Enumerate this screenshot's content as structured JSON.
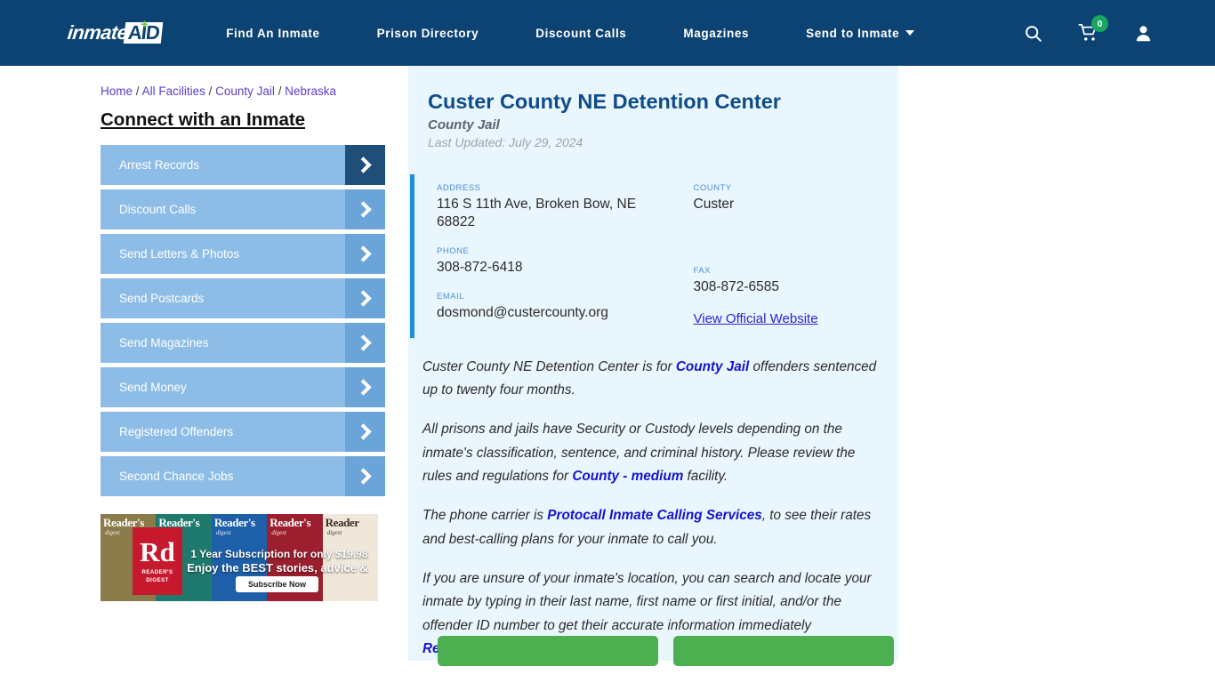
{
  "brand": {
    "logo_primary": "inmate",
    "logo_secondary": "AID",
    "logo_plus": "+",
    "colors": {
      "header_bg": "#0d4372",
      "card_bg": "#eaf6fd",
      "accent_bar": "#1f8fe0",
      "title_blue": "#0f4c8c",
      "link_blue": "#1414cf",
      "cta_green": "#4caf50",
      "badge_green": "#1aa563",
      "sidebar_btn": "#8dbde6",
      "sidebar_arrow": "#6aa4d8",
      "sidebar_arrow_active": "#1f4e79"
    }
  },
  "nav": {
    "links": [
      {
        "label": "Find An Inmate"
      },
      {
        "label": "Prison Directory"
      },
      {
        "label": "Discount Calls"
      },
      {
        "label": "Magazines"
      },
      {
        "label": "Send to Inmate"
      }
    ],
    "icons": {
      "search": "search-icon",
      "cart": "cart-icon",
      "account": "user-icon"
    },
    "cart_count": "0"
  },
  "breadcrumb": {
    "items": [
      "Home",
      "All Facilities",
      "County Jail",
      "Nebraska"
    ],
    "separator": "/"
  },
  "sidebar": {
    "title": "Connect with an Inmate",
    "items": [
      {
        "label": "Arrest Records",
        "active": true
      },
      {
        "label": "Discount Calls",
        "active": false
      },
      {
        "label": "Send Letters & Photos",
        "active": false
      },
      {
        "label": "Send Postcards",
        "active": false
      },
      {
        "label": "Send Magazines",
        "active": false
      },
      {
        "label": "Send Money",
        "active": false
      },
      {
        "label": "Registered Offenders",
        "active": false
      },
      {
        "label": "Second Chance Jobs",
        "active": false
      }
    ]
  },
  "ad": {
    "brand_mark": "Rd",
    "brand_sub": "READER'S\nDIGEST",
    "headline": "1 Year Subscription for only $19.98",
    "subhead": "Enjoy the BEST stories, advice & jokes!",
    "cta": "Subscribe Now",
    "covers": [
      {
        "title": "Reader's",
        "sub": "digest"
      },
      {
        "title": "Reader's",
        "sub": "digest"
      },
      {
        "title": "Reader's",
        "sub": "digest"
      },
      {
        "title": "Reader's",
        "sub": "digest"
      },
      {
        "title": "Reader",
        "sub": "digest"
      }
    ]
  },
  "facility": {
    "name": "Custer County NE Detention Center",
    "type": "County Jail",
    "last_updated": "Last Updated: July 29, 2024",
    "info": {
      "address_label": "ADDRESS",
      "address_value": "116 S 11th Ave, Broken Bow, NE 68822",
      "county_label": "COUNTY",
      "county_value": "Custer",
      "phone_label": "PHONE",
      "phone_value": "308-872-6418",
      "fax_label": "FAX",
      "fax_value": "308-872-6585",
      "email_label": "EMAIL",
      "email_value": "dosmond@custercounty.org",
      "website_link": "View Official Website"
    }
  },
  "description": {
    "p1_a": "Custer County NE Detention Center is for ",
    "p1_link": "County Jail",
    "p1_b": " offenders sentenced up to twenty four months.",
    "p2_a": "All prisons and jails have Security or Custody levels depending on the inmate's classification, sentence, and criminal history. Please review the rules and regulations for ",
    "p2_link": "County - medium",
    "p2_b": " facility.",
    "p3_a": "The phone carrier is ",
    "p3_link": "Protocall Inmate Calling Services",
    "p3_b": ", to see their rates and best-calling plans for your inmate to call you.",
    "p4_a": "If you are unsure of your inmate's location, you can search and locate your inmate by typing in their last name, first name or first initial, and/or the offender ID number to get their accurate information immediately ",
    "p4_link": "Registered Offenders"
  },
  "cta_buttons": [
    {
      "label": ""
    },
    {
      "label": ""
    }
  ]
}
